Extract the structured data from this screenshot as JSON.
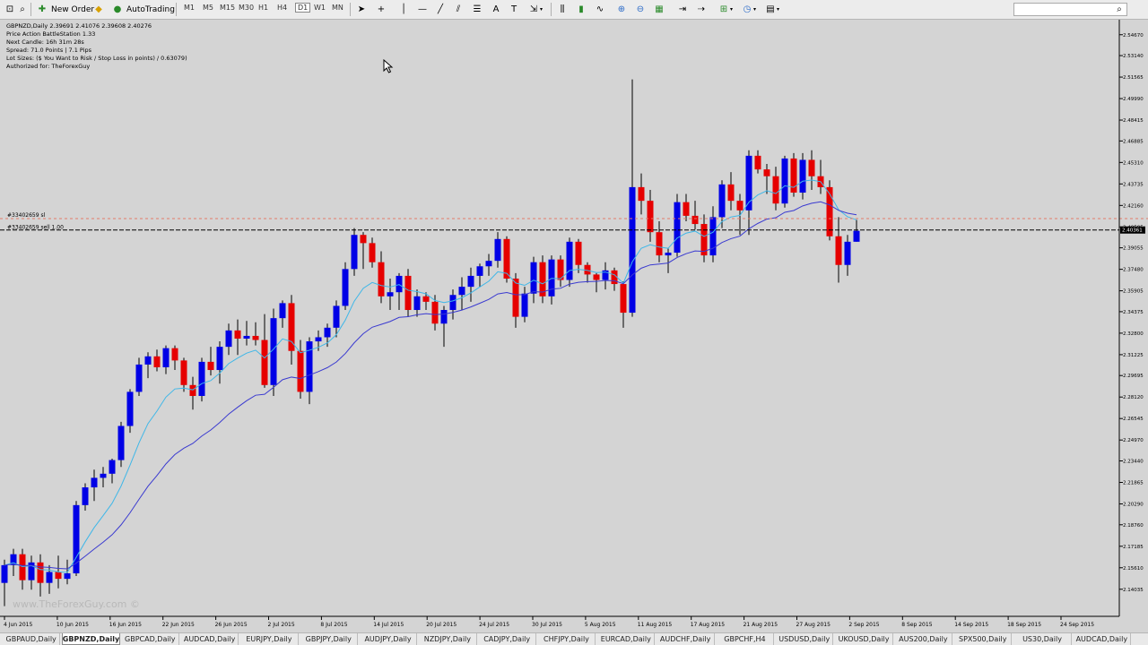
{
  "toolbar": {
    "new_order": "New Order",
    "autotrading": "AutoTrading",
    "timeframes": [
      "M1",
      "M5",
      "M15",
      "M30",
      "H1",
      "H4",
      "D1",
      "W1",
      "MN"
    ],
    "active_timeframe": "D1"
  },
  "info_lines": [
    "GBPNZD,Daily  2.39691 2.41076 2.39608 2.40276",
    "Price Action BattleStation 1.33",
    "Next Candle: 16h 31m 28s",
    "Spread: 71.0 Points | 7.1 Pips",
    "Lot Sizes: ($ You Want to Risk / Stop Loss in points) / 0.63079)",
    "Authorized for: TheForexGuy"
  ],
  "order_labels": {
    "sl": "#33402659 sl",
    "sell": "#33402659 sell 1.00"
  },
  "watermark": "www.TheForexGuy.com ©",
  "current_price_label": "2.40361",
  "chart_data": {
    "type": "candlestick",
    "ylim": [
      2.1205,
      2.5577
    ],
    "y_ticks": [
      "2.54670",
      "2.53140",
      "2.51565",
      "2.49990",
      "2.48415",
      "2.46885",
      "2.45310",
      "2.43735",
      "2.42160",
      "2.40585",
      "2.39055",
      "2.37480",
      "2.35905",
      "2.34375",
      "2.32800",
      "2.31225",
      "2.29695",
      "2.28120",
      "2.26545",
      "2.24970",
      "2.23440",
      "2.21865",
      "2.20290",
      "2.18760",
      "2.17185",
      "2.15610",
      "2.14035"
    ],
    "x_ticks": [
      "4 Jun 2015",
      "10 Jun 2015",
      "16 Jun 2015",
      "22 Jun 2015",
      "26 Jun 2015",
      "2 Jul 2015",
      "8 Jul 2015",
      "14 Jul 2015",
      "20 Jul 2015",
      "24 Jul 2015",
      "30 Jul 2015",
      "5 Aug 2015",
      "11 Aug 2015",
      "17 Aug 2015",
      "21 Aug 2015",
      "27 Aug 2015",
      "2 Sep 2015",
      "8 Sep 2015",
      "14 Sep 2015",
      "18 Sep 2015",
      "24 Sep 2015"
    ],
    "current_price": 2.40361,
    "order_sl_level": 2.412,
    "order_sell_level": 2.40361,
    "candles": [
      {
        "o": 2.145,
        "h": 2.162,
        "l": 2.128,
        "c": 2.158
      },
      {
        "o": 2.158,
        "h": 2.17,
        "l": 2.15,
        "c": 2.166
      },
      {
        "o": 2.166,
        "h": 2.17,
        "l": 2.14,
        "c": 2.147
      },
      {
        "o": 2.147,
        "h": 2.165,
        "l": 2.14,
        "c": 2.16
      },
      {
        "o": 2.16,
        "h": 2.166,
        "l": 2.135,
        "c": 2.145
      },
      {
        "o": 2.145,
        "h": 2.158,
        "l": 2.137,
        "c": 2.153
      },
      {
        "o": 2.153,
        "h": 2.165,
        "l": 2.141,
        "c": 2.148
      },
      {
        "o": 2.148,
        "h": 2.162,
        "l": 2.144,
        "c": 2.152
      },
      {
        "o": 2.152,
        "h": 2.205,
        "l": 2.15,
        "c": 2.202
      },
      {
        "o": 2.202,
        "h": 2.218,
        "l": 2.198,
        "c": 2.215
      },
      {
        "o": 2.215,
        "h": 2.228,
        "l": 2.205,
        "c": 2.222
      },
      {
        "o": 2.222,
        "h": 2.23,
        "l": 2.215,
        "c": 2.225
      },
      {
        "o": 2.225,
        "h": 2.236,
        "l": 2.218,
        "c": 2.235
      },
      {
        "o": 2.235,
        "h": 2.263,
        "l": 2.23,
        "c": 2.26
      },
      {
        "o": 2.26,
        "h": 2.287,
        "l": 2.255,
        "c": 2.285
      },
      {
        "o": 2.285,
        "h": 2.31,
        "l": 2.282,
        "c": 2.305
      },
      {
        "o": 2.305,
        "h": 2.314,
        "l": 2.295,
        "c": 2.311
      },
      {
        "o": 2.311,
        "h": 2.316,
        "l": 2.3,
        "c": 2.303
      },
      {
        "o": 2.303,
        "h": 2.319,
        "l": 2.298,
        "c": 2.317
      },
      {
        "o": 2.317,
        "h": 2.319,
        "l": 2.301,
        "c": 2.308
      },
      {
        "o": 2.308,
        "h": 2.31,
        "l": 2.285,
        "c": 2.29
      },
      {
        "o": 2.29,
        "h": 2.296,
        "l": 2.272,
        "c": 2.282
      },
      {
        "o": 2.282,
        "h": 2.31,
        "l": 2.278,
        "c": 2.307
      },
      {
        "o": 2.307,
        "h": 2.318,
        "l": 2.297,
        "c": 2.301
      },
      {
        "o": 2.301,
        "h": 2.322,
        "l": 2.291,
        "c": 2.318
      },
      {
        "o": 2.318,
        "h": 2.335,
        "l": 2.312,
        "c": 2.33
      },
      {
        "o": 2.33,
        "h": 2.338,
        "l": 2.312,
        "c": 2.324
      },
      {
        "o": 2.324,
        "h": 2.337,
        "l": 2.319,
        "c": 2.326
      },
      {
        "o": 2.326,
        "h": 2.336,
        "l": 2.319,
        "c": 2.323
      },
      {
        "o": 2.323,
        "h": 2.342,
        "l": 2.288,
        "c": 2.29
      },
      {
        "o": 2.29,
        "h": 2.346,
        "l": 2.282,
        "c": 2.339
      },
      {
        "o": 2.339,
        "h": 2.352,
        "l": 2.332,
        "c": 2.35
      },
      {
        "o": 2.35,
        "h": 2.356,
        "l": 2.305,
        "c": 2.315
      },
      {
        "o": 2.315,
        "h": 2.323,
        "l": 2.28,
        "c": 2.285
      },
      {
        "o": 2.285,
        "h": 2.325,
        "l": 2.276,
        "c": 2.322
      },
      {
        "o": 2.322,
        "h": 2.33,
        "l": 2.315,
        "c": 2.325
      },
      {
        "o": 2.325,
        "h": 2.335,
        "l": 2.318,
        "c": 2.332
      },
      {
        "o": 2.332,
        "h": 2.352,
        "l": 2.325,
        "c": 2.348
      },
      {
        "o": 2.348,
        "h": 2.38,
        "l": 2.345,
        "c": 2.375
      },
      {
        "o": 2.375,
        "h": 2.405,
        "l": 2.37,
        "c": 2.4
      },
      {
        "o": 2.4,
        "h": 2.402,
        "l": 2.375,
        "c": 2.394
      },
      {
        "o": 2.394,
        "h": 2.398,
        "l": 2.376,
        "c": 2.38
      },
      {
        "o": 2.38,
        "h": 2.388,
        "l": 2.35,
        "c": 2.355
      },
      {
        "o": 2.355,
        "h": 2.368,
        "l": 2.345,
        "c": 2.358
      },
      {
        "o": 2.358,
        "h": 2.372,
        "l": 2.345,
        "c": 2.37
      },
      {
        "o": 2.37,
        "h": 2.375,
        "l": 2.34,
        "c": 2.345
      },
      {
        "o": 2.345,
        "h": 2.36,
        "l": 2.34,
        "c": 2.355
      },
      {
        "o": 2.355,
        "h": 2.358,
        "l": 2.345,
        "c": 2.351
      },
      {
        "o": 2.351,
        "h": 2.356,
        "l": 2.33,
        "c": 2.335
      },
      {
        "o": 2.335,
        "h": 2.348,
        "l": 2.318,
        "c": 2.345
      },
      {
        "o": 2.345,
        "h": 2.36,
        "l": 2.338,
        "c": 2.356
      },
      {
        "o": 2.356,
        "h": 2.369,
        "l": 2.345,
        "c": 2.362
      },
      {
        "o": 2.362,
        "h": 2.376,
        "l": 2.351,
        "c": 2.37
      },
      {
        "o": 2.37,
        "h": 2.379,
        "l": 2.362,
        "c": 2.377
      },
      {
        "o": 2.377,
        "h": 2.386,
        "l": 2.37,
        "c": 2.381
      },
      {
        "o": 2.381,
        "h": 2.402,
        "l": 2.376,
        "c": 2.397
      },
      {
        "o": 2.397,
        "h": 2.399,
        "l": 2.365,
        "c": 2.368
      },
      {
        "o": 2.368,
        "h": 2.372,
        "l": 2.332,
        "c": 2.34
      },
      {
        "o": 2.34,
        "h": 2.362,
        "l": 2.336,
        "c": 2.357
      },
      {
        "o": 2.357,
        "h": 2.384,
        "l": 2.35,
        "c": 2.38
      },
      {
        "o": 2.38,
        "h": 2.385,
        "l": 2.35,
        "c": 2.355
      },
      {
        "o": 2.355,
        "h": 2.385,
        "l": 2.349,
        "c": 2.382
      },
      {
        "o": 2.382,
        "h": 2.385,
        "l": 2.362,
        "c": 2.367
      },
      {
        "o": 2.367,
        "h": 2.398,
        "l": 2.362,
        "c": 2.395
      },
      {
        "o": 2.395,
        "h": 2.397,
        "l": 2.372,
        "c": 2.378
      },
      {
        "o": 2.378,
        "h": 2.38,
        "l": 2.365,
        "c": 2.371
      },
      {
        "o": 2.371,
        "h": 2.372,
        "l": 2.358,
        "c": 2.367
      },
      {
        "o": 2.367,
        "h": 2.38,
        "l": 2.36,
        "c": 2.374
      },
      {
        "o": 2.374,
        "h": 2.376,
        "l": 2.359,
        "c": 2.364
      },
      {
        "o": 2.364,
        "h": 2.366,
        "l": 2.332,
        "c": 2.343
      },
      {
        "o": 2.343,
        "h": 2.514,
        "l": 2.34,
        "c": 2.435
      },
      {
        "o": 2.435,
        "h": 2.445,
        "l": 2.415,
        "c": 2.425
      },
      {
        "o": 2.425,
        "h": 2.433,
        "l": 2.395,
        "c": 2.402
      },
      {
        "o": 2.402,
        "h": 2.41,
        "l": 2.38,
        "c": 2.385
      },
      {
        "o": 2.385,
        "h": 2.39,
        "l": 2.372,
        "c": 2.387
      },
      {
        "o": 2.387,
        "h": 2.43,
        "l": 2.384,
        "c": 2.424
      },
      {
        "o": 2.424,
        "h": 2.43,
        "l": 2.41,
        "c": 2.414
      },
      {
        "o": 2.414,
        "h": 2.425,
        "l": 2.404,
        "c": 2.408
      },
      {
        "o": 2.408,
        "h": 2.415,
        "l": 2.38,
        "c": 2.385
      },
      {
        "o": 2.385,
        "h": 2.421,
        "l": 2.38,
        "c": 2.413
      },
      {
        "o": 2.413,
        "h": 2.44,
        "l": 2.405,
        "c": 2.437
      },
      {
        "o": 2.437,
        "h": 2.446,
        "l": 2.418,
        "c": 2.425
      },
      {
        "o": 2.425,
        "h": 2.43,
        "l": 2.4,
        "c": 2.418
      },
      {
        "o": 2.418,
        "h": 2.462,
        "l": 2.4,
        "c": 2.458
      },
      {
        "o": 2.458,
        "h": 2.462,
        "l": 2.445,
        "c": 2.448
      },
      {
        "o": 2.448,
        "h": 2.452,
        "l": 2.43,
        "c": 2.443
      },
      {
        "o": 2.443,
        "h": 2.45,
        "l": 2.418,
        "c": 2.423
      },
      {
        "o": 2.423,
        "h": 2.458,
        "l": 2.42,
        "c": 2.456
      },
      {
        "o": 2.456,
        "h": 2.46,
        "l": 2.428,
        "c": 2.431
      },
      {
        "o": 2.431,
        "h": 2.46,
        "l": 2.426,
        "c": 2.455
      },
      {
        "o": 2.455,
        "h": 2.462,
        "l": 2.433,
        "c": 2.443
      },
      {
        "o": 2.443,
        "h": 2.455,
        "l": 2.43,
        "c": 2.435
      },
      {
        "o": 2.435,
        "h": 2.44,
        "l": 2.396,
        "c": 2.399
      },
      {
        "o": 2.399,
        "h": 2.413,
        "l": 2.365,
        "c": 2.378
      },
      {
        "o": 2.378,
        "h": 2.4,
        "l": 2.37,
        "c": 2.395
      },
      {
        "o": 2.395,
        "h": 2.411,
        "l": 2.395,
        "c": 2.403
      }
    ]
  },
  "tabs": [
    "GBPAUD,Daily",
    "GBPNZD,Daily",
    "GBPCAD,Daily",
    "AUDCAD,Daily",
    "EURJPY,Daily",
    "GBPJPY,Daily",
    "AUDJPY,Daily",
    "NZDJPY,Daily",
    "CADJPY,Daily",
    "CHFJPY,Daily",
    "EURCAD,Daily",
    "AUDCHF,Daily",
    "GBPCHF,H4",
    "USDUSD,Daily",
    "UKOUSD,Daily",
    "AUS200,Daily",
    "SPX500,Daily",
    "US30,Daily",
    "AUDCAD,Daily"
  ],
  "active_tab": "GBPNZD,Daily",
  "colors": {
    "bull": "#0000e6",
    "bear": "#e60000",
    "doji": "#f5deb3",
    "ema_fast": "#3fb7e8",
    "ema_slow": "#3a3ad0",
    "chart_bg": "#d4d4d4"
  }
}
